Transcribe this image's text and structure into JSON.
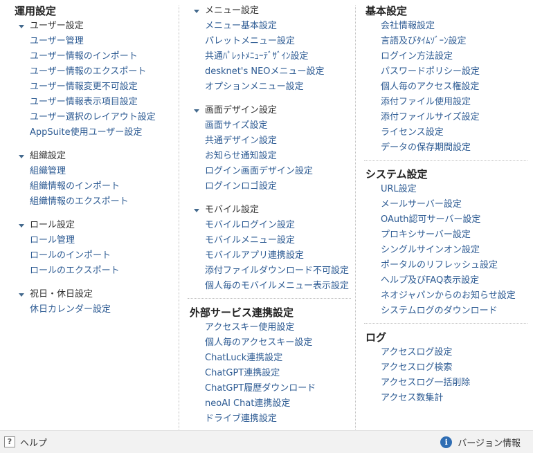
{
  "col1": {
    "title": "運用設定",
    "groups": [
      {
        "label": "ユーザー設定",
        "items": [
          "ユーザー管理",
          "ユーザー情報のインポート",
          "ユーザー情報のエクスポート",
          "ユーザー情報変更不可設定",
          "ユーザー情報表示項目設定",
          "ユーザー選択のレイアウト設定",
          "AppSuite使用ユーザー設定"
        ]
      },
      {
        "label": "組織設定",
        "items": [
          "組織管理",
          "組織情報のインポート",
          "組織情報のエクスポート"
        ]
      },
      {
        "label": "ロール設定",
        "items": [
          "ロール管理",
          "ロールのインポート",
          "ロールのエクスポート"
        ]
      },
      {
        "label": "祝日・休日設定",
        "items": [
          "休日カレンダー設定"
        ]
      }
    ]
  },
  "col2": {
    "groups": [
      {
        "label": "メニュー設定",
        "items": [
          "メニュー基本設定",
          "パレットメニュー設定",
          "共通ﾊﾟﾚｯﾄﾒﾆｭｰﾃﾞｻﾞｲﾝ設定",
          "desknet's NEOメニュー設定",
          "オプションメニュー設定"
        ]
      },
      {
        "label": "画面デザイン設定",
        "items": [
          "画面サイズ設定",
          "共通デザイン設定",
          "お知らせ通知設定",
          "ログイン画面デザイン設定",
          "ログインロゴ設定"
        ]
      },
      {
        "label": "モバイル設定",
        "items": [
          "モバイルログイン設定",
          "モバイルメニュー設定",
          "モバイルアプリ連携設定",
          "添付ファイルダウンロード不可設定",
          "個人毎のモバイルメニュー表示設定"
        ]
      }
    ],
    "external": {
      "title": "外部サービス連携設定",
      "items": [
        "アクセスキー使用設定",
        "個人毎のアクセスキー設定",
        "ChatLuck連携設定",
        "ChatGPT連携設定",
        "ChatGPT履歴ダウンロード",
        "neoAI Chat連携設定",
        "ドライブ連携設定"
      ]
    }
  },
  "col3": {
    "basic": {
      "title": "基本設定",
      "items": [
        "会社情報設定",
        "言語及びﾀｲﾑｿﾞｰﾝ設定",
        "ログイン方法設定",
        "パスワードポリシー設定",
        "個人毎のアクセス権設定",
        "添付ファイル使用設定",
        "添付ファイルサイズ設定",
        "ライセンス設定",
        "データの保存期間設定"
      ]
    },
    "system": {
      "title": "システム設定",
      "items": [
        "URL設定",
        "メールサーバー設定",
        "OAuth認可サーバー設定",
        "プロキシサーバー設定",
        "シングルサインオン設定",
        "ポータルのリフレッシュ設定",
        "ヘルプ及びFAQ表示設定",
        "ネオジャパンからのお知らせ設定",
        "システムログのダウンロード"
      ]
    },
    "log": {
      "title": "ログ",
      "items": [
        "アクセスログ設定",
        "アクセスログ検索",
        "アクセスログ一括削除",
        "アクセス数集計"
      ]
    }
  },
  "footer": {
    "help_label": "ヘルプ",
    "help_icon_glyph": "?",
    "version_label": "バージョン情報",
    "info_icon_glyph": "i"
  },
  "colors": {
    "link": "#2d5b93",
    "caret": "#446a8e",
    "footer_bg": "#f2f2f2",
    "info_icon": "#2f6db3"
  }
}
